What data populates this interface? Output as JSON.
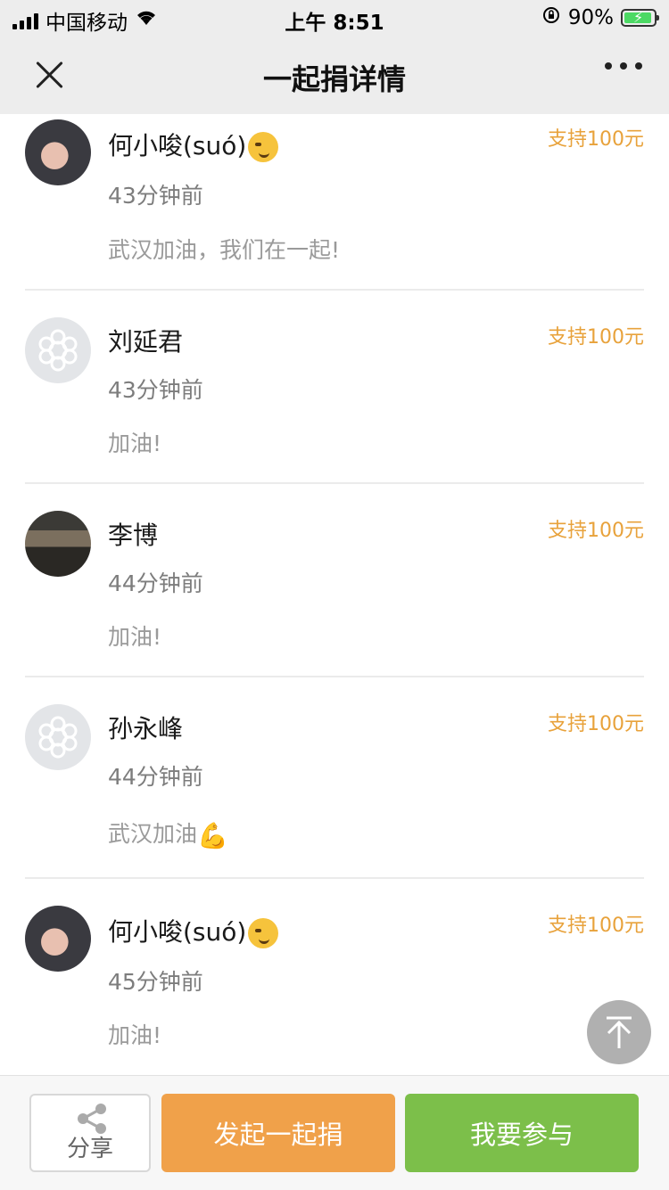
{
  "status_bar": {
    "carrier": "中国移动",
    "time": "上午 8:51",
    "battery_percent": "90%"
  },
  "nav": {
    "title": "一起捐详情"
  },
  "donations": [
    {
      "name": "何小唆(suó)",
      "emoji": "smirk",
      "amount": "支持100元",
      "time": "43分钟前",
      "message": "武汉加油，我们在一起!"
    },
    {
      "name": "刘延君",
      "amount": "支持100元",
      "time": "43分钟前",
      "message": "加油!"
    },
    {
      "name": "李博",
      "amount": "支持100元",
      "time": "44分钟前",
      "message": "加油!"
    },
    {
      "name": "孙永峰",
      "amount": "支持100元",
      "time": "44分钟前",
      "message": "武汉加油",
      "message_emoji": "muscle"
    },
    {
      "name": "何小唆(suó)",
      "emoji": "smirk",
      "amount": "支持100元",
      "time": "45分钟前",
      "message": "加油!"
    }
  ],
  "bottom": {
    "share_label": "分享",
    "launch_label": "发起一起捐",
    "join_label": "我要参与"
  },
  "colors": {
    "amount": "#e8a23b",
    "launch_button": "#f0a14a",
    "join_button": "#7cbf4a",
    "nav_bg": "#ededed"
  }
}
